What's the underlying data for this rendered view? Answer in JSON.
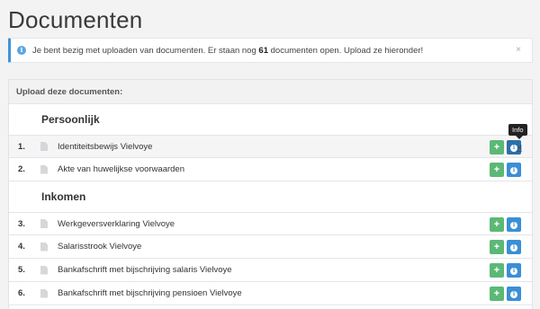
{
  "page": {
    "title": "Documenten"
  },
  "alert": {
    "text_before": "Je bent bezig met uploaden van documenten. Er staan nog ",
    "count": "61",
    "text_after": " documenten open. Upload ze hieronder!",
    "close": "×"
  },
  "panel": {
    "heading": "Upload deze documenten:"
  },
  "sections": [
    {
      "title": "Persoonlijk",
      "items": [
        {
          "num": "1.",
          "name": "Identiteitsbewijs Vielvoye"
        },
        {
          "num": "2.",
          "name": "Akte van huwelijkse voorwaarden"
        }
      ]
    },
    {
      "title": "Inkomen",
      "items": [
        {
          "num": "3.",
          "name": "Werkgeversverklaring Vielvoye"
        },
        {
          "num": "4.",
          "name": "Salarisstrook Vielvoye"
        },
        {
          "num": "5.",
          "name": "Bankafschrift met bijschrijving salaris Vielvoye"
        },
        {
          "num": "6.",
          "name": "Bankafschrift met bijschrijving pensioen Vielvoye"
        }
      ]
    }
  ],
  "buttons": {
    "add": "+",
    "info": "i"
  },
  "tooltip": {
    "text": "Info"
  },
  "colors": {
    "accent": "#3b8fd6",
    "success": "#5cb876"
  }
}
